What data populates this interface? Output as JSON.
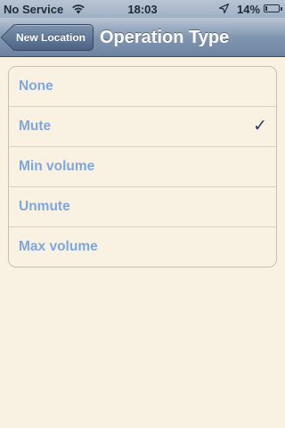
{
  "status_bar": {
    "carrier": "No Service",
    "time": "18:03",
    "battery_percent": "14%",
    "wifi_icon": "wifi-icon",
    "location_icon": "location-arrow-icon",
    "battery_icon": "battery-icon",
    "battery_level": 0.14
  },
  "nav_bar": {
    "back_label": "New Location",
    "title": "Operation Type"
  },
  "options": [
    {
      "label": "None",
      "selected": false
    },
    {
      "label": "Mute",
      "selected": true
    },
    {
      "label": "Min volume",
      "selected": false
    },
    {
      "label": "Unmute",
      "selected": false
    },
    {
      "label": "Max volume",
      "selected": false
    }
  ],
  "checkmark_glyph": "✓",
  "colors": {
    "background": "#f9f1e2",
    "option_text": "#7fa7df",
    "checkmark": "#2b3e63",
    "nav_bar": "#8196b0"
  }
}
